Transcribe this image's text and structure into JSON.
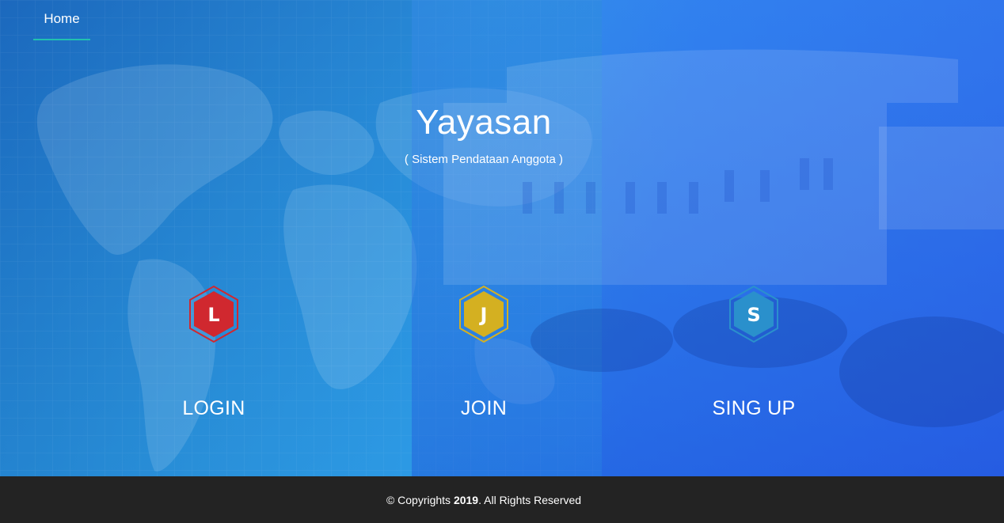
{
  "nav": {
    "home_label": "Home"
  },
  "hero": {
    "title": "Yayasan",
    "subtitle": "( Sistem Pendataan Anggota )"
  },
  "actions": [
    {
      "label": "LOGIN",
      "icon_letter": "L",
      "icon": "hexagon-l-icon",
      "color": "#d0282f"
    },
    {
      "label": "JOIN",
      "icon_letter": "J",
      "icon": "hexagon-j-icon",
      "color": "#d4b021"
    },
    {
      "label": "SING UP",
      "icon_letter": "S",
      "icon": "hexagon-s-icon",
      "color": "#2a90cc"
    }
  ],
  "footer": {
    "prefix": "© Copyrights ",
    "year": "2019",
    "suffix": ". All Rights Reserved"
  },
  "colors": {
    "accent_underline": "#21c1b0",
    "footer_bg": "#232323",
    "hero_blue": "#2a7fe3"
  }
}
